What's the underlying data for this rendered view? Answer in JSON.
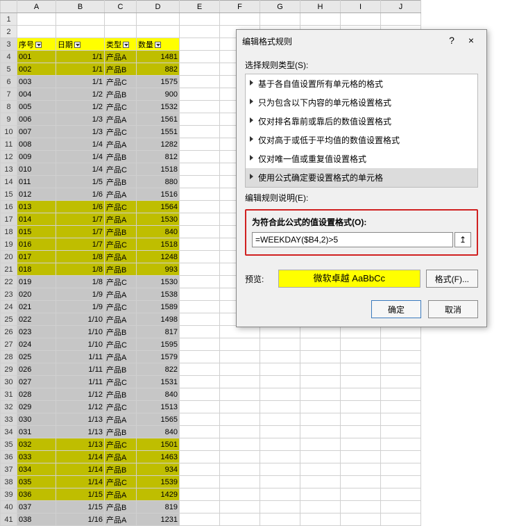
{
  "columns": [
    "A",
    "B",
    "C",
    "D",
    "E",
    "F",
    "G",
    "H",
    "I",
    "J"
  ],
  "headers": {
    "seq": "序号",
    "date": "日期",
    "type": "类型",
    "qty": "数量"
  },
  "rows": [
    {
      "r": 4,
      "seq": "001",
      "date": "1/1",
      "type": "产品A",
      "qty": 1481,
      "hl": true
    },
    {
      "r": 5,
      "seq": "002",
      "date": "1/1",
      "type": "产品B",
      "qty": 882,
      "hl": true
    },
    {
      "r": 6,
      "seq": "003",
      "date": "1/1",
      "type": "产品C",
      "qty": 1575,
      "hl": false
    },
    {
      "r": 7,
      "seq": "004",
      "date": "1/2",
      "type": "产品B",
      "qty": 900,
      "hl": false
    },
    {
      "r": 8,
      "seq": "005",
      "date": "1/2",
      "type": "产品C",
      "qty": 1532,
      "hl": false
    },
    {
      "r": 9,
      "seq": "006",
      "date": "1/3",
      "type": "产品A",
      "qty": 1561,
      "hl": false
    },
    {
      "r": 10,
      "seq": "007",
      "date": "1/3",
      "type": "产品C",
      "qty": 1551,
      "hl": false
    },
    {
      "r": 11,
      "seq": "008",
      "date": "1/4",
      "type": "产品A",
      "qty": 1282,
      "hl": false
    },
    {
      "r": 12,
      "seq": "009",
      "date": "1/4",
      "type": "产品B",
      "qty": 812,
      "hl": false
    },
    {
      "r": 13,
      "seq": "010",
      "date": "1/4",
      "type": "产品C",
      "qty": 1518,
      "hl": false
    },
    {
      "r": 14,
      "seq": "011",
      "date": "1/5",
      "type": "产品B",
      "qty": 880,
      "hl": false
    },
    {
      "r": 15,
      "seq": "012",
      "date": "1/6",
      "type": "产品A",
      "qty": 1516,
      "hl": false
    },
    {
      "r": 16,
      "seq": "013",
      "date": "1/6",
      "type": "产品C",
      "qty": 1564,
      "hl": true
    },
    {
      "r": 17,
      "seq": "014",
      "date": "1/7",
      "type": "产品A",
      "qty": 1530,
      "hl": true
    },
    {
      "r": 18,
      "seq": "015",
      "date": "1/7",
      "type": "产品B",
      "qty": 840,
      "hl": true
    },
    {
      "r": 19,
      "seq": "016",
      "date": "1/7",
      "type": "产品C",
      "qty": 1518,
      "hl": true
    },
    {
      "r": 20,
      "seq": "017",
      "date": "1/8",
      "type": "产品A",
      "qty": 1248,
      "hl": true
    },
    {
      "r": 21,
      "seq": "018",
      "date": "1/8",
      "type": "产品B",
      "qty": 993,
      "hl": true
    },
    {
      "r": 22,
      "seq": "019",
      "date": "1/8",
      "type": "产品C",
      "qty": 1530,
      "hl": false
    },
    {
      "r": 23,
      "seq": "020",
      "date": "1/9",
      "type": "产品A",
      "qty": 1538,
      "hl": false
    },
    {
      "r": 24,
      "seq": "021",
      "date": "1/9",
      "type": "产品C",
      "qty": 1589,
      "hl": false
    },
    {
      "r": 25,
      "seq": "022",
      "date": "1/10",
      "type": "产品A",
      "qty": 1498,
      "hl": false
    },
    {
      "r": 26,
      "seq": "023",
      "date": "1/10",
      "type": "产品B",
      "qty": 817,
      "hl": false
    },
    {
      "r": 27,
      "seq": "024",
      "date": "1/10",
      "type": "产品C",
      "qty": 1595,
      "hl": false
    },
    {
      "r": 28,
      "seq": "025",
      "date": "1/11",
      "type": "产品A",
      "qty": 1579,
      "hl": false
    },
    {
      "r": 29,
      "seq": "026",
      "date": "1/11",
      "type": "产品B",
      "qty": 822,
      "hl": false
    },
    {
      "r": 30,
      "seq": "027",
      "date": "1/11",
      "type": "产品C",
      "qty": 1531,
      "hl": false
    },
    {
      "r": 31,
      "seq": "028",
      "date": "1/12",
      "type": "产品B",
      "qty": 840,
      "hl": false
    },
    {
      "r": 32,
      "seq": "029",
      "date": "1/12",
      "type": "产品C",
      "qty": 1513,
      "hl": false
    },
    {
      "r": 33,
      "seq": "030",
      "date": "1/13",
      "type": "产品A",
      "qty": 1565,
      "hl": false
    },
    {
      "r": 34,
      "seq": "031",
      "date": "1/13",
      "type": "产品B",
      "qty": 840,
      "hl": false
    },
    {
      "r": 35,
      "seq": "032",
      "date": "1/13",
      "type": "产品C",
      "qty": 1501,
      "hl": true
    },
    {
      "r": 36,
      "seq": "033",
      "date": "1/14",
      "type": "产品A",
      "qty": 1463,
      "hl": true
    },
    {
      "r": 37,
      "seq": "034",
      "date": "1/14",
      "type": "产品B",
      "qty": 934,
      "hl": true
    },
    {
      "r": 38,
      "seq": "035",
      "date": "1/14",
      "type": "产品C",
      "qty": 1539,
      "hl": true
    },
    {
      "r": 39,
      "seq": "036",
      "date": "1/15",
      "type": "产品A",
      "qty": 1429,
      "hl": true
    },
    {
      "r": 40,
      "seq": "037",
      "date": "1/15",
      "type": "产品B",
      "qty": 819,
      "hl": false
    },
    {
      "r": 41,
      "seq": "038",
      "date": "1/16",
      "type": "产品A",
      "qty": 1231,
      "hl": false
    }
  ],
  "dialog": {
    "title": "编辑格式规则",
    "help": "?",
    "close": "×",
    "select_rule_type": "选择规则类型(S):",
    "rule_types": [
      "基于各自值设置所有单元格的格式",
      "只为包含以下内容的单元格设置格式",
      "仅对排名靠前或靠后的数值设置格式",
      "仅对高于或低于平均值的数值设置格式",
      "仅对唯一值或重复值设置格式",
      "使用公式确定要设置格式的单元格"
    ],
    "selected_rule_index": 5,
    "edit_description": "编辑规则说明(E):",
    "formula_label": "为符合此公式的值设置格式(O):",
    "formula": "=WEEKDAY($B4,2)>5",
    "preview_label": "预览:",
    "preview_text": "微软卓越 AaBbCc",
    "format_btn": "格式(F)...",
    "ok": "确定",
    "cancel": "取消",
    "range_btn": "↥"
  }
}
